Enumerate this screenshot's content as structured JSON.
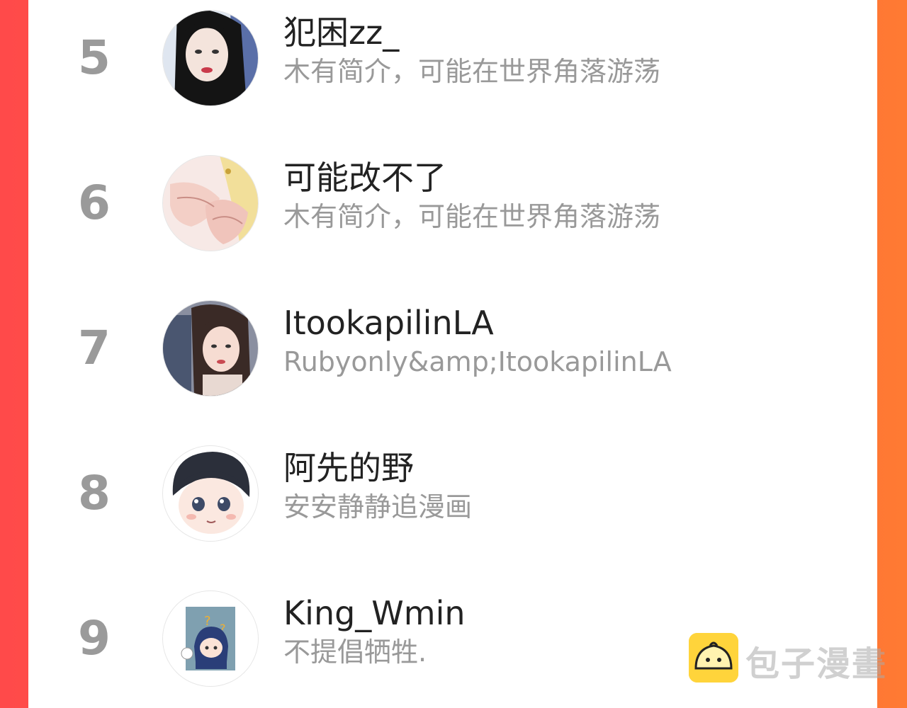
{
  "ranking": {
    "items": [
      {
        "rank": "5",
        "name": "犯困zz_",
        "bio": "木有简介，可能在世界角落游荡",
        "avatar": "user-avatar-dark-hair-girl"
      },
      {
        "rank": "6",
        "name": "可能改不了",
        "bio": "木有简介，可能在世界角落游荡",
        "avatar": "user-avatar-anime-hands"
      },
      {
        "rank": "7",
        "name": "ItookapilinLA",
        "bio": "Rubyonly&amp;ItookapilinLA",
        "avatar": "user-avatar-portrait-girl"
      },
      {
        "rank": "8",
        "name": "阿先的野",
        "bio": "安安静静追漫画",
        "avatar": "user-avatar-chibi-boy"
      },
      {
        "rank": "9",
        "name": "King_Wmin",
        "bio": "不提倡牺牲.",
        "avatar": "user-avatar-chibi-confused"
      }
    ]
  },
  "watermark": {
    "text": "包子漫畫",
    "icon": "bun-logo-icon"
  },
  "colors": {
    "frame_left": "#ff4a4a",
    "frame_right": "#ff7a33",
    "rank": "#9a9a9a",
    "name": "#222222",
    "bio": "#999999",
    "logo": "#ffd43b"
  }
}
